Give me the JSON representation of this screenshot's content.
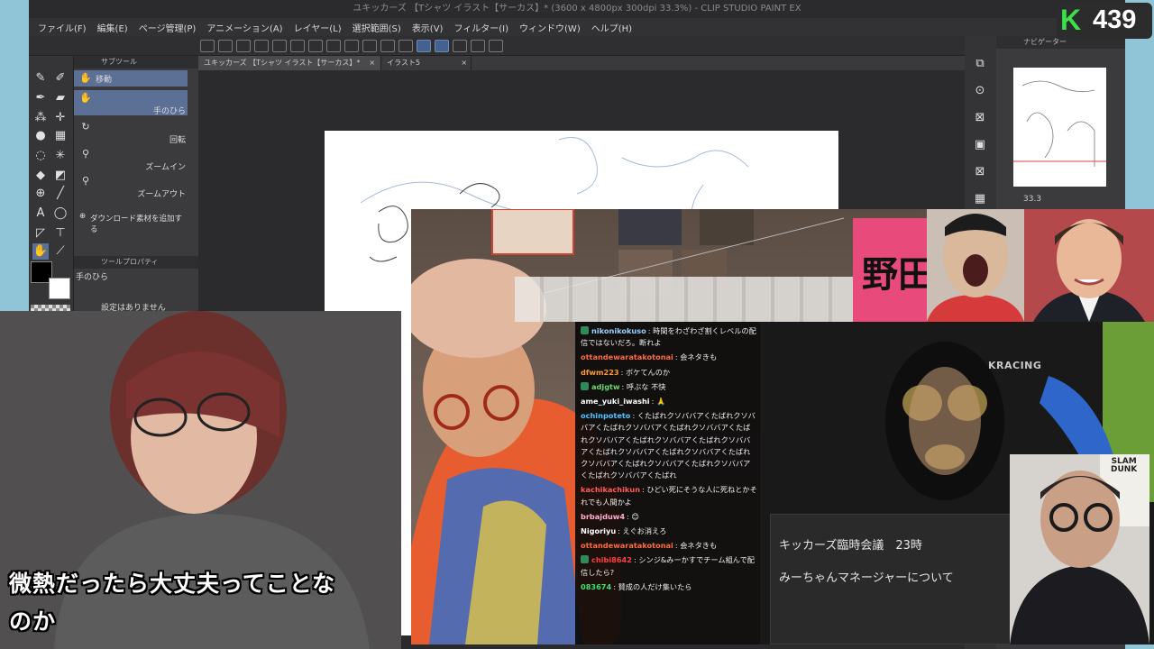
{
  "window": {
    "title": "ユキッカーズ 【Tシャツ イラスト【サーカス】* (3600 x 4800px 300dpi 33.3%) - CLIP STUDIO PAINT EX"
  },
  "menu": [
    "ファイル(F)",
    "編集(E)",
    "ページ管理(P)",
    "アニメーション(A)",
    "レイヤー(L)",
    "選択範囲(S)",
    "表示(V)",
    "フィルター(I)",
    "ウィンドウ(W)",
    "ヘルプ(H)"
  ],
  "subtool": {
    "header": "サブツール",
    "items": [
      {
        "label": "移動",
        "icon": "hand-icon"
      },
      {
        "label": "手のひら",
        "icon": "hand-icon"
      },
      {
        "label": "回転",
        "icon": "rotate-icon"
      },
      {
        "label": "ズームイン",
        "icon": "zoom-in-icon"
      },
      {
        "label": "ズームアウト",
        "icon": "zoom-out-icon"
      }
    ],
    "add_material": "ダウンロード素材を追加する"
  },
  "tool_property": {
    "header": "ツールプロパティ",
    "tool_name": "手のひら",
    "empty_note": "設定はありません"
  },
  "tabs": [
    {
      "label": "ユキッカーズ 【Tシャツ イラスト【サーカス】*",
      "active": true
    },
    {
      "label": "イラスト5",
      "active": false
    }
  ],
  "navigator": {
    "header": "ナビゲーター",
    "zoom": "33.3"
  },
  "badge": {
    "logo": "K",
    "count": "439",
    "color": "#3be04a"
  },
  "collab": {
    "banner_text": "野田",
    "chair_brand": "KRACING",
    "poster_text": "SLAM\nDUNK",
    "note_line1": "キッカーズ臨時会議　23時",
    "note_line2": "みーちゃんマネージャーについて"
  },
  "chat": [
    {
      "user": "nikonikokuso",
      "color": "#9ad0ff",
      "text": "時間をわざわざ割くレベルの配信ではないだろ。断れよ"
    },
    {
      "user": "ottandewaratakotonai",
      "color": "#ff6b3d",
      "text": "会ネタきも"
    },
    {
      "user": "dfwm223",
      "color": "#ff9a2e",
      "text": "ボケてんのか"
    },
    {
      "user": "adjgtw",
      "color": "#6fd36f",
      "text": "呼ぶな 不快"
    },
    {
      "user": "ame_yuki_iwashi",
      "color": "#ffffff",
      "text": "🙏"
    },
    {
      "user": "ochinpoteto",
      "color": "#4fc3ff",
      "text": "くたばれクソババアくたばれクソババアくたばれクソババアくたばれクソババアくたばれクソババアくたばれクソババアくたばれクソババアくたばれクソババアくたばれクソババアくたばれクソババアくたばれクソババアくたばれクソババアくたばれクソババアくたばれ"
    },
    {
      "user": "kachikachikun",
      "color": "#ff5a5a",
      "text": "ひどい死にそうな人に死ねとかそれでも人間かよ"
    },
    {
      "user": "brbajduw4",
      "color": "#ffb0d0",
      "text": "😊"
    },
    {
      "user": "Nigoriyu",
      "color": "#ffffff",
      "text": "えぐお消えろ"
    },
    {
      "user": "ottandewaratakotonai",
      "color": "#ff6b3d",
      "text": "会ネタきも"
    },
    {
      "user": "chibi8642",
      "color": "#ff4040",
      "text": "シンジ&みーかすでチーム組んで配信したら?"
    },
    {
      "user": "083674",
      "color": "#3fe06a",
      "text": "賛成の人だけ集いたら"
    }
  ],
  "subtitle": {
    "line1": "微熱だったら大丈夫ってことな",
    "line2": "のか"
  }
}
